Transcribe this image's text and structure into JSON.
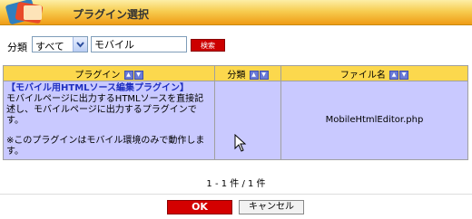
{
  "header": {
    "title": "プラグイン選択"
  },
  "filter": {
    "label": "分類",
    "category_value": "すべて",
    "search_value": "モバイル",
    "search_button": "検索"
  },
  "table": {
    "columns": [
      "プラグイン",
      "分類",
      "ファイル名"
    ],
    "rows": [
      {
        "name": "【モバイル用HTMLソース編集プラグイン】",
        "desc1": "モバイルページに出力するHTMLソースを直接記述し、モバイルページに出力するプラグインです。",
        "desc2": "※このプラグインはモバイル環境のみで動作します。",
        "category": "",
        "file": "MobileHtmlEditor.php"
      }
    ]
  },
  "pager": {
    "text": "1 - 1 件 / 1 件"
  },
  "buttons": {
    "ok": "OK",
    "cancel": "キャンセル"
  }
}
